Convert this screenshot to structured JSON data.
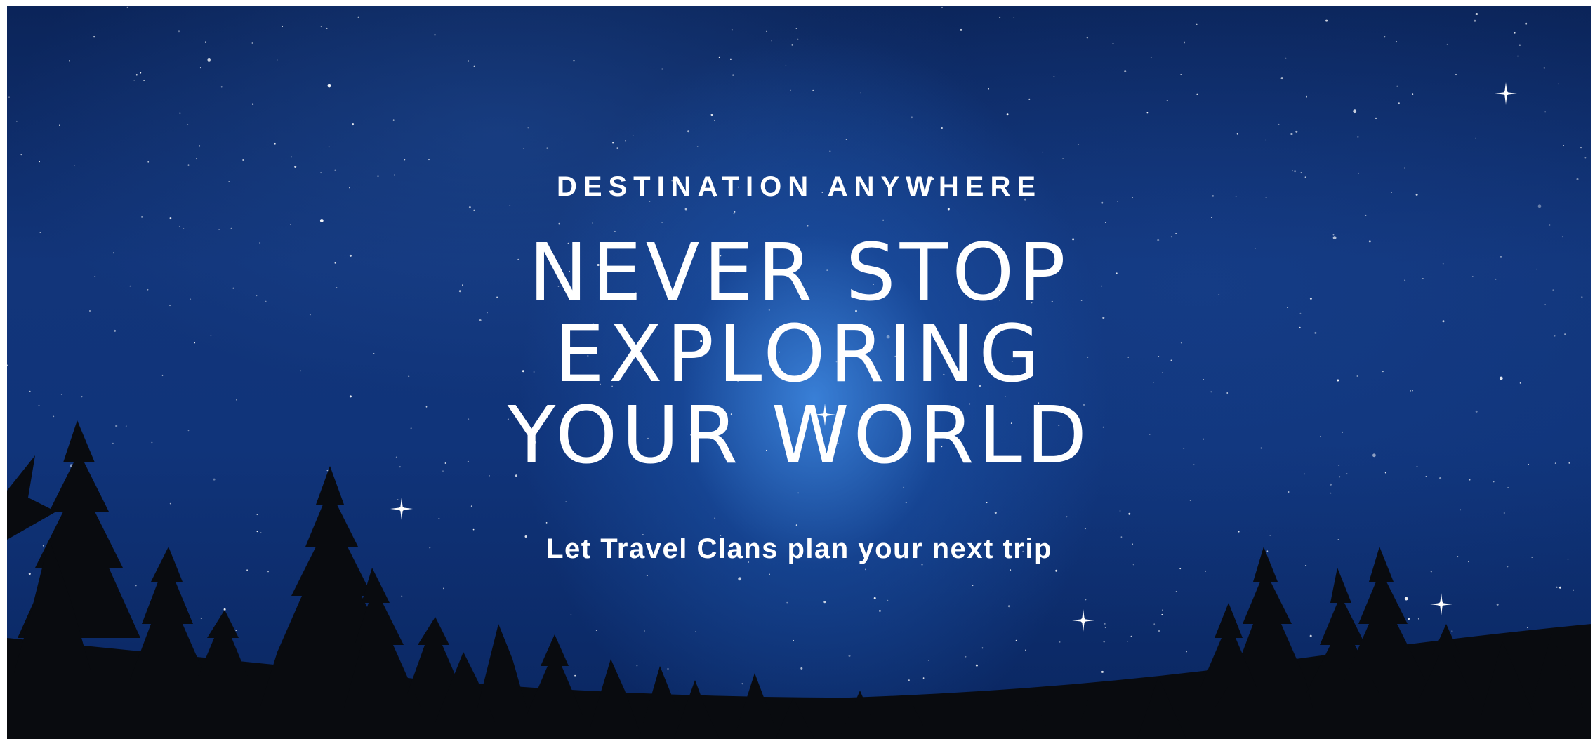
{
  "hero": {
    "eyebrow": "DESTINATION ANYWHERE",
    "headline": [
      "NEVER STOP",
      "EXPLORING",
      "YOUR WORLD"
    ],
    "tagline": "Let Travel Clans plan your next trip"
  },
  "colors": {
    "sky_top": "#0b2459",
    "sky_glow": "#408ce6",
    "tree_silhouette": "#0a0c10",
    "text": "#ffffff"
  },
  "background": {
    "image": "night-sky-with-pine-trees"
  }
}
